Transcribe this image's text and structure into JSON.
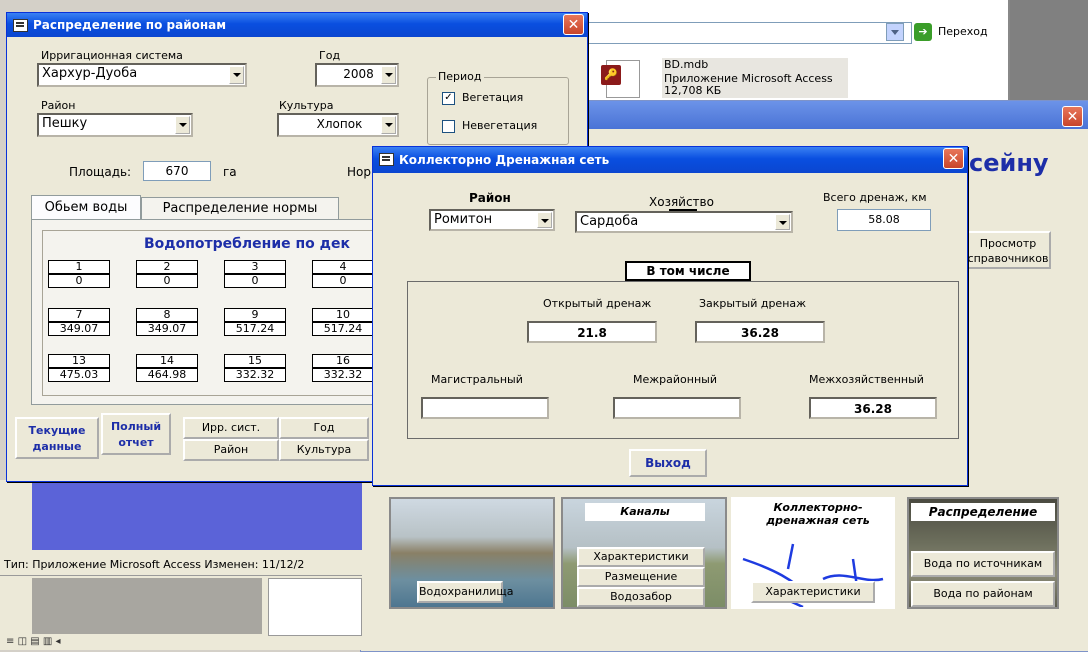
{
  "explorer": {
    "go_label": "Переход",
    "file_name": "BD.mdb",
    "file_type": "Приложение Microsoft Access",
    "file_size": "12,708 КБ",
    "status": "Тип: Приложение Microsoft Access Изменен: 11/12/2"
  },
  "main_heading_fragment": "сейну",
  "spravochniki_button": [
    "Просмотр",
    "справочников"
  ],
  "cards": {
    "reservoirs": {
      "title": "",
      "buttons": [
        "Водохранилища"
      ]
    },
    "canals": {
      "title": "Каналы",
      "buttons": [
        "Характеристики",
        "Размещение",
        "Водозабор"
      ]
    },
    "drainage": {
      "title": "Коллекторно-дренажная сеть",
      "title_lines": [
        "Коллекторно-",
        "дренажная сеть"
      ],
      "buttons": [
        "Характеристики"
      ]
    },
    "distribution": {
      "title": "Распределение",
      "buttons": [
        "Вода по источникам",
        "Вода по районам"
      ]
    }
  },
  "dist_form": {
    "title": "Распределение по районам",
    "irrigation_label": "Ирригационная система",
    "irrigation_value": "Хархур-Дуоба",
    "year_label": "Год",
    "year_value": "2008",
    "district_label": "Район",
    "district_value": "Пешку",
    "crop_label": "Культура",
    "crop_value": "Хлопок",
    "period_label": "Период",
    "period_options": [
      {
        "label": "Вегетация",
        "checked": true
      },
      {
        "label": "Невегетация",
        "checked": false
      }
    ],
    "area_label": "Площадь:",
    "area_value": "670",
    "area_unit": "га",
    "norm_fragment": "Нор",
    "tabs": [
      "Обьем воды",
      "Распределение нормы"
    ],
    "grid_title": "Водопотребление по дек",
    "grid_rows": [
      {
        "heads": [
          "1",
          "2",
          "3",
          "4"
        ],
        "values": [
          "0",
          "0",
          "0",
          "0"
        ]
      },
      {
        "heads": [
          "7",
          "8",
          "9",
          "10"
        ],
        "values": [
          "349.07",
          "349.07",
          "517.24",
          "517.24"
        ]
      },
      {
        "heads": [
          "13",
          "14",
          "15",
          "16"
        ],
        "values": [
          "475.03",
          "464.98",
          "332.32",
          "332.32"
        ]
      }
    ],
    "btn_current": [
      "Текущие",
      "данные"
    ],
    "btn_full": [
      "Полный",
      "отчет"
    ],
    "btn_irr": "Ирр. сист.",
    "btn_year": "Год",
    "btn_district": "Район",
    "btn_crop": "Культура"
  },
  "kds_form": {
    "title": "Коллекторно Дренажная сеть",
    "district_label": "Район",
    "district_value": "Ромитон",
    "farm_label": "Хозяйство",
    "farm_value": "Сардоба",
    "total_label": "Всего дренаж, км",
    "total_value": "58.08",
    "including_label": "В том числе",
    "open_label": "Открытый дренаж",
    "open_value": "21.8",
    "closed_label": "Закрытый дренаж",
    "closed_value": "36.28",
    "mag_label": "Магистральный",
    "mag_value": "",
    "interdistrict_label": "Межрайонный",
    "interdistrict_value": "",
    "interfarm_label": "Межхозяйственный",
    "interfarm_value": "36.28",
    "exit_label": "Выход"
  },
  "colors": {
    "titlebar": "#0a4fe0",
    "grid_title": "#1d2ea8",
    "desktop_panel": "#5b63d8"
  }
}
